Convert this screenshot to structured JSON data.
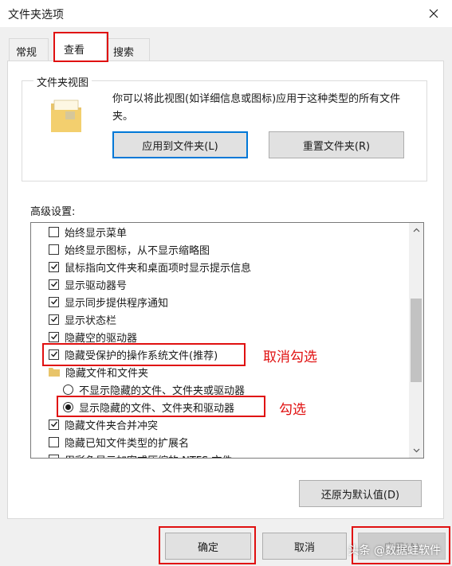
{
  "window": {
    "title": "文件夹选项"
  },
  "tabs": [
    {
      "label": "常规",
      "active": false
    },
    {
      "label": "查看",
      "active": true
    },
    {
      "label": "搜索",
      "active": false
    }
  ],
  "folder_views": {
    "legend": "文件夹视图",
    "description": "你可以将此视图(如详细信息或图标)应用于这种类型的所有文件夹。",
    "apply_label": "应用到文件夹(L)",
    "reset_label": "重置文件夹(R)"
  },
  "advanced": {
    "label": "高级设置:",
    "items": [
      {
        "type": "checkbox",
        "label": "始终显示菜单",
        "checked": false
      },
      {
        "type": "checkbox",
        "label": "始终显示图标，从不显示缩略图",
        "checked": false
      },
      {
        "type": "checkbox",
        "label": "鼠标指向文件夹和桌面项时显示提示信息",
        "checked": true
      },
      {
        "type": "checkbox",
        "label": "显示驱动器号",
        "checked": true
      },
      {
        "type": "checkbox",
        "label": "显示同步提供程序通知",
        "checked": true
      },
      {
        "type": "checkbox",
        "label": "显示状态栏",
        "checked": true
      },
      {
        "type": "checkbox",
        "label": "隐藏空的驱动器",
        "checked": true
      },
      {
        "type": "checkbox",
        "label": "隐藏受保护的操作系统文件(推荐)",
        "checked": true
      },
      {
        "type": "folder",
        "label": "隐藏文件和文件夹"
      },
      {
        "type": "radio",
        "label": "不显示隐藏的文件、文件夹或驱动器",
        "checked": false
      },
      {
        "type": "radio",
        "label": "显示隐藏的文件、文件夹和驱动器",
        "checked": true
      },
      {
        "type": "checkbox",
        "label": "隐藏文件夹合并冲突",
        "checked": true
      },
      {
        "type": "checkbox",
        "label": "隐藏已知文件类型的扩展名",
        "checked": false
      },
      {
        "type": "checkbox",
        "label": "用彩色显示加密或压缩的 NTFS 文件",
        "checked": false
      }
    ],
    "restore_label": "还原为默认值(D)"
  },
  "annotations": {
    "uncheck": "取消勾选",
    "check": "勾选"
  },
  "footer": {
    "ok_label": "确定",
    "cancel_label": "取消",
    "apply_label": "应用(A)"
  },
  "watermark": "头条 @数据蛙软件",
  "colors": {
    "highlight": "#e01010",
    "focus_border": "#0078d7"
  }
}
